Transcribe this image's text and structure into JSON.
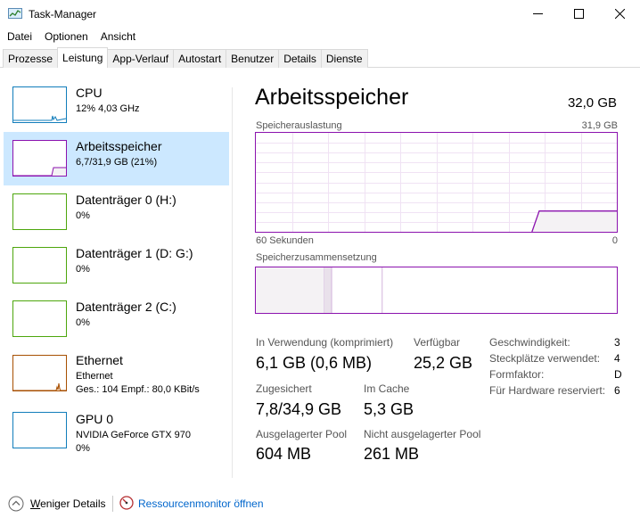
{
  "window": {
    "title": "Task-Manager",
    "controls": {
      "minimize": "minimize",
      "maximize": "maximize",
      "close": "close"
    }
  },
  "menu": [
    "Datei",
    "Optionen",
    "Ansicht"
  ],
  "tabs": [
    "Prozesse",
    "Leistung",
    "App-Verlauf",
    "Autostart",
    "Benutzer",
    "Details",
    "Dienste"
  ],
  "active_tab": "Leistung",
  "sidebar": [
    {
      "title": "CPU",
      "sub1": "12%  4,03 GHz",
      "sub2": "",
      "sub3": "",
      "color": "#117dbb"
    },
    {
      "title": "Arbeitsspeicher",
      "sub1": "6,7/31,9 GB (21%)",
      "sub2": "",
      "sub3": "",
      "color": "#8b12ae"
    },
    {
      "title": "Datenträger 0 (H:)",
      "sub1": "0%",
      "sub2": "",
      "sub3": "",
      "color": "#4da60c"
    },
    {
      "title": "Datenträger 1 (D: G:)",
      "sub1": "0%",
      "sub2": "",
      "sub3": "",
      "color": "#4da60c"
    },
    {
      "title": "Datenträger 2 (C:)",
      "sub1": "0%",
      "sub2": "",
      "sub3": "",
      "color": "#4da60c"
    },
    {
      "title": "Ethernet",
      "sub1": "Ethernet",
      "sub2": "Ges.: 104  Empf.: 80,0 KBit/s",
      "sub3": "",
      "color": "#a74f01"
    },
    {
      "title": "GPU 0",
      "sub1": "NVIDIA GeForce GTX 970",
      "sub2": "0%",
      "sub3": "",
      "color": "#117dbb"
    }
  ],
  "main": {
    "title": "Arbeitsspeicher",
    "total": "32,0 GB",
    "usage_label": "Speicherauslastung",
    "usage_max": "31,9 GB",
    "time_left": "60 Sekunden",
    "time_right": "0",
    "composition_label": "Speicherzusammensetzung",
    "usage_fraction": 0.21,
    "composition": {
      "in_use": 0.19,
      "modified": 0.02,
      "standby": 0.14
    },
    "stats": [
      {
        "label": "In Verwendung (komprimiert)",
        "value": "6,1 GB (0,6 MB)"
      },
      {
        "label": "Verfügbar",
        "value": "25,2 GB"
      },
      {
        "label": "Zugesichert",
        "value": "7,8/34,9 GB"
      },
      {
        "label": "Im Cache",
        "value": "5,3 GB"
      },
      {
        "label": "Ausgelagerter Pool",
        "value": "604 MB"
      },
      {
        "label": "Nicht ausgelagerter Pool",
        "value": "261 MB"
      }
    ],
    "props": [
      {
        "label": "Geschwindigkeit:",
        "value": "3"
      },
      {
        "label": "Steckplätze verwendet:",
        "value": "4"
      },
      {
        "label": "Formfaktor:",
        "value": "D"
      },
      {
        "label": "Für Hardware reserviert:",
        "value": "6"
      }
    ]
  },
  "footer": {
    "fewer_details_first": "W",
    "fewer_details_rest": "eniger Details",
    "resource_monitor": "Ressourcenmonitor öffnen"
  },
  "colors": {
    "memory": "#8b12ae",
    "memory_fill": "#f4f2f4",
    "selected_bg": "#cce8ff",
    "link": "#0066cc"
  }
}
